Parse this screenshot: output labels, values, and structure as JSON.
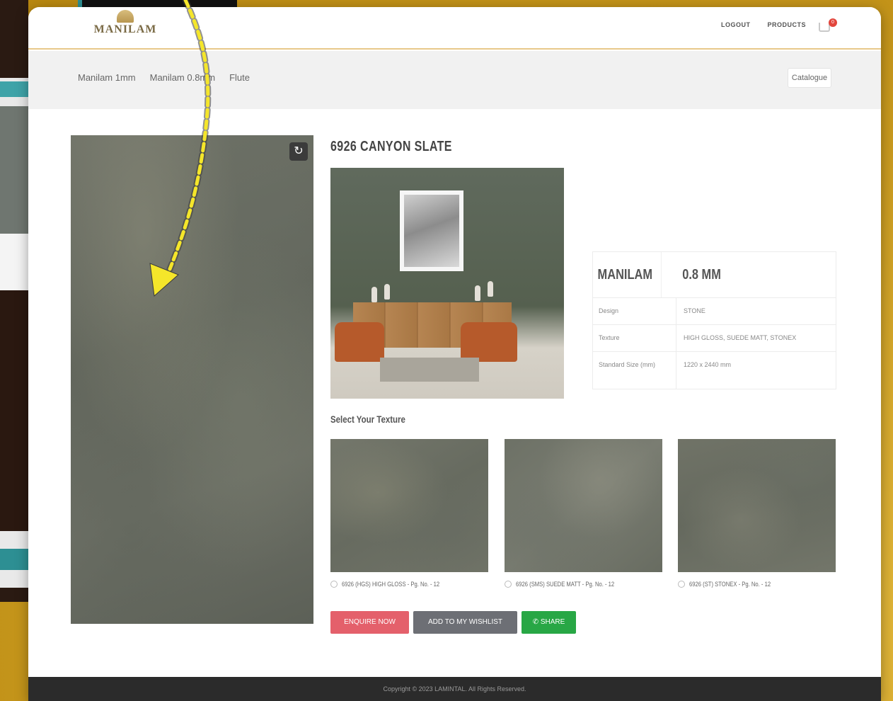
{
  "header": {
    "logo_text": "MANILAM",
    "logo_tagline": "",
    "links": [
      "LOGOUT",
      "PRODUCTS"
    ],
    "cart_count": "0"
  },
  "subnav": {
    "items": [
      "Manilam 1mm",
      "Manilam 0.8mm",
      "Flute"
    ],
    "catalogue_label": "Catalogue"
  },
  "product": {
    "title": "6926 CANYON SLATE",
    "spec_head": [
      "MANILAM",
      "0.8 MM"
    ],
    "specs": [
      {
        "key": "Design",
        "value": "STONE"
      },
      {
        "key": "Texture",
        "value": "HIGH GLOSS, SUEDE MATT, STONEX"
      },
      {
        "key": "Standard Size (mm)",
        "value": "1220 x 2440 mm"
      }
    ],
    "select_texture_label": "Select Your Texture",
    "textures": [
      {
        "caption": "6926 (HGS) HIGH GLOSS - Pg. No. - 12"
      },
      {
        "caption": "6926 (SMS) SUEDE MATT - Pg. No. - 12"
      },
      {
        "caption": "6926 (ST) STONEX - Pg. No. - 12"
      }
    ],
    "buttons": {
      "enquire": "ENQUIRE NOW",
      "wishlist": "ADD TO MY WISHLIST",
      "share": "SHARE"
    }
  },
  "footer": {
    "copyright": "Copyright © 2023 LAMINTAL. All Rights Reserved."
  },
  "icons": {
    "rotate": "rotate-icon",
    "cart": "cart-icon",
    "share": "whatsapp-icon"
  },
  "colors": {
    "accent_gold": "#e8c98a",
    "enquire": "#e4606b",
    "wishlist": "#6d6f75",
    "share": "#28a745",
    "annotation_arrow": "#f5e62a"
  }
}
